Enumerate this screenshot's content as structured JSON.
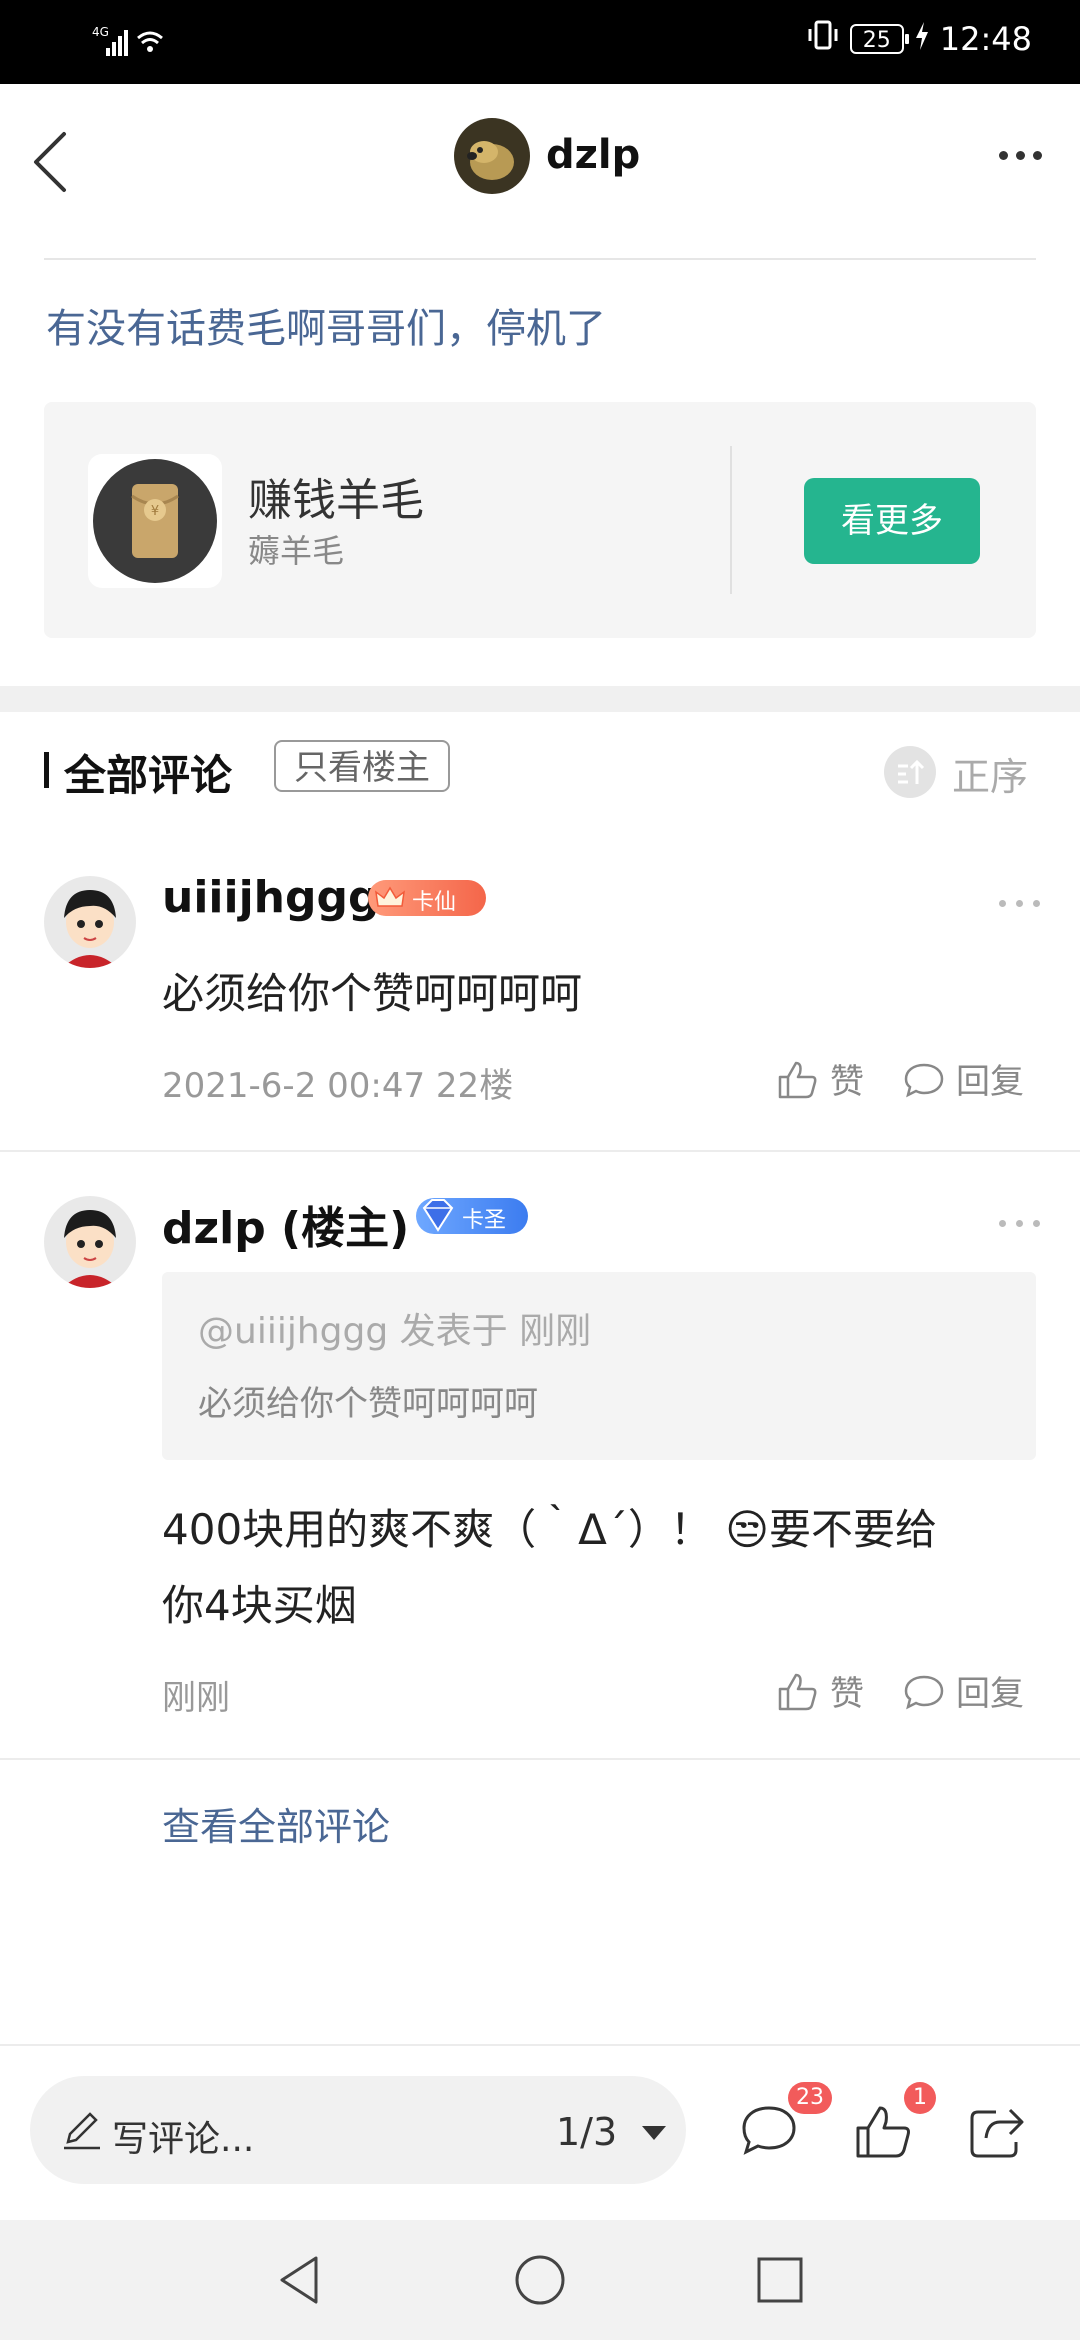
{
  "status_bar": {
    "network": "4G",
    "battery": "25",
    "time": "12:48"
  },
  "header": {
    "username": "dzlp"
  },
  "post": {
    "title": "有没有话费毛啊哥哥们，停机了"
  },
  "forum_card": {
    "name": "赚钱羊毛",
    "subtitle": "薅羊毛",
    "button_label": "看更多"
  },
  "comments_section": {
    "title": "全部评论",
    "filter_label": "只看楼主",
    "sort_label": "正序"
  },
  "comments": [
    {
      "username": "uiiijhggg",
      "badge": "卡仙",
      "text": "必须给你个赞呵呵呵呵",
      "meta": "2021-6-2 00:47  22楼",
      "like_label": "赞",
      "reply_label": "回复"
    },
    {
      "username": "dzlp (楼主)",
      "badge": "卡圣",
      "quote_meta": "@uiiijhggg 发表于 刚刚",
      "quote_text": "必须给你个赞呵呵呵呵",
      "text_line1": "400块用的爽不爽（｀Δ´）！ 😒要不要给",
      "text_line2": "你4块买烟",
      "meta": "刚刚",
      "like_label": "赞",
      "reply_label": "回复"
    }
  ],
  "view_all_label": "查看全部评论",
  "bottom_bar": {
    "placeholder": "写评论...",
    "page": "1/3",
    "comment_count": "23",
    "like_count": "1"
  },
  "colors": {
    "accent": "#25b58f",
    "link": "#4a6794",
    "badge": "#f25b5b"
  }
}
